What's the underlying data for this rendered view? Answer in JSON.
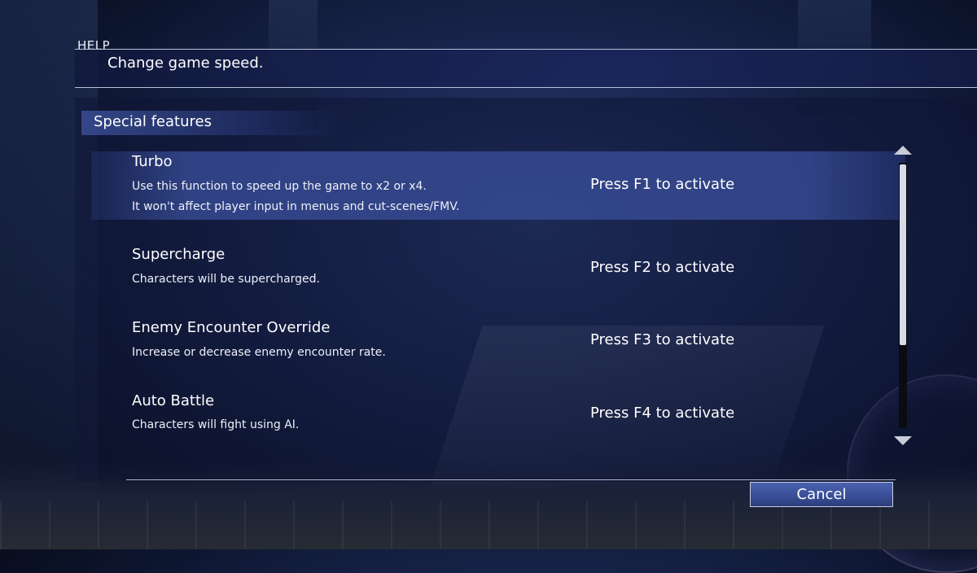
{
  "help": {
    "label": "HELP",
    "text": "Change game speed."
  },
  "section": {
    "title": "Special features"
  },
  "features": [
    {
      "title": "Turbo",
      "desc": [
        "Use this function to speed up the game to x2 or x4.",
        "It won't affect player input in menus and cut-scenes/FMV."
      ],
      "action": "Press F1 to activate",
      "selected": true
    },
    {
      "title": "Supercharge",
      "desc": [
        "Characters will be supercharged."
      ],
      "action": "Press F2 to activate",
      "selected": false
    },
    {
      "title": "Enemy Encounter Override",
      "desc": [
        "Increase or decrease enemy encounter rate."
      ],
      "action": "Press F3 to activate",
      "selected": false
    },
    {
      "title": "Auto Battle",
      "desc": [
        "Characters will fight using AI."
      ],
      "action": "Press F4 to activate",
      "selected": false
    }
  ],
  "buttons": {
    "cancel": "Cancel"
  },
  "colors": {
    "selected_row": "#384c96",
    "panel": "#0e1434",
    "button": "#3a4f98"
  },
  "icons": {
    "scroll_up": "scroll-up-arrow-icon",
    "scroll_down": "scroll-down-arrow-icon"
  }
}
